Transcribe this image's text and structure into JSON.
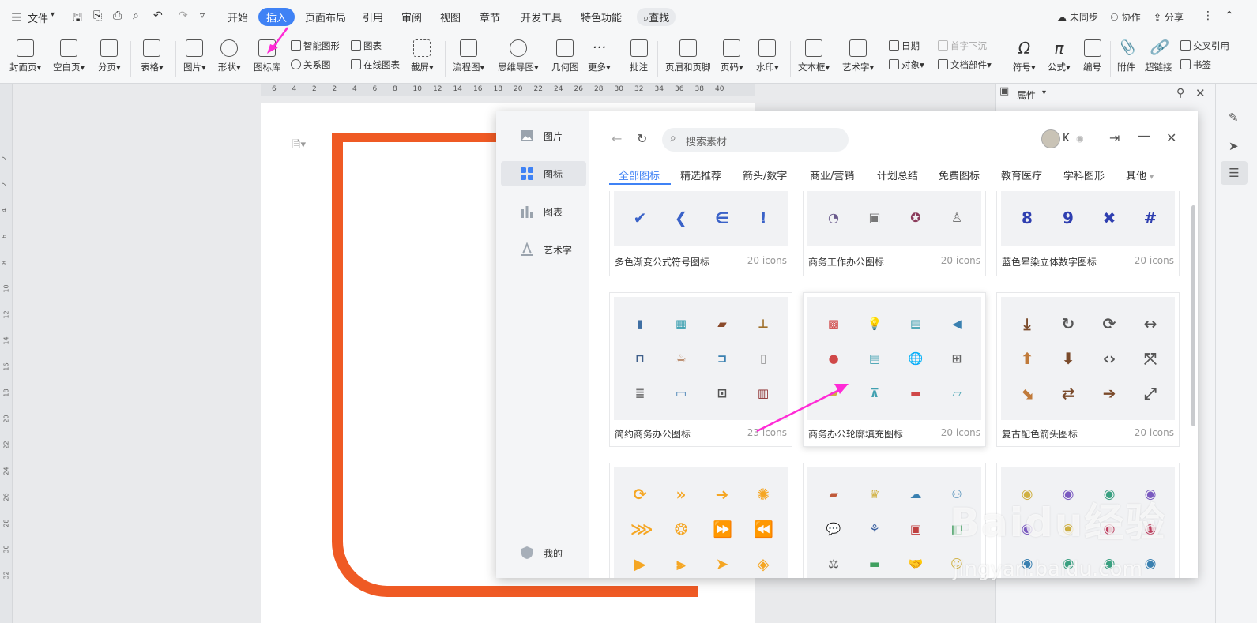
{
  "menubar": {
    "file_label": "文件",
    "tabs": [
      "开始",
      "插入",
      "页面布局",
      "引用",
      "审阅",
      "视图",
      "章节",
      "开发工具",
      "特色功能"
    ],
    "active_tab": "插入",
    "search_label": "查找",
    "sync_label": "未同步",
    "collab_label": "协作",
    "share_label": "分享"
  },
  "ribbon": {
    "big_items": [
      "封面页",
      "空白页",
      "分页",
      "表格",
      "图片",
      "形状",
      "图标库",
      "截屏",
      "流程图",
      "思维导图",
      "几何图",
      "更多",
      "批注",
      "页眉和页脚",
      "页码",
      "水印",
      "文本框",
      "艺术字",
      "符号",
      "公式",
      "编号",
      "附件",
      "超链接"
    ],
    "small_items": [
      "智能图形",
      "图表",
      "关系图",
      "在线图表",
      "日期",
      "首字下沉",
      "对象",
      "文档部件",
      "交叉引用",
      "书签"
    ]
  },
  "ruler": {
    "top_numbers": [
      "6",
      "4",
      "2",
      "2",
      "4",
      "6",
      "8",
      "10",
      "12",
      "14",
      "16",
      "18",
      "20",
      "22",
      "24",
      "26",
      "28",
      "30",
      "32",
      "34",
      "36",
      "38",
      "40"
    ],
    "left_numbers": [
      "2",
      "2",
      "4",
      "6",
      "8",
      "10",
      "12",
      "14",
      "16",
      "18",
      "20",
      "22",
      "24",
      "26",
      "28",
      "30",
      "32"
    ]
  },
  "props_panel": {
    "title": "属性"
  },
  "dialog": {
    "sidebar": [
      {
        "label": "图片",
        "icon": "image-icon"
      },
      {
        "label": "图标",
        "icon": "icon-grid-icon"
      },
      {
        "label": "图表",
        "icon": "bar-chart-icon"
      },
      {
        "label": "艺术字",
        "icon": "art-text-icon"
      }
    ],
    "sidebar_active": "图标",
    "mine_label": "我的",
    "search_placeholder": "搜索素材",
    "user_name": "K",
    "categories": [
      "全部图标",
      "精选推荐",
      "箭头/数字",
      "商业/营销",
      "计划总结",
      "免费图标",
      "教育医疗",
      "学科图形",
      "其他"
    ],
    "active_category": "全部图标",
    "cards": [
      {
        "name": "多色渐变公式符号图标",
        "count": "20 icons"
      },
      {
        "name": "商务工作办公图标",
        "count": "20 icons"
      },
      {
        "name": "蓝色晕染立体数字图标",
        "count": "20 icons"
      },
      {
        "name": "简约商务办公图标",
        "count": "23 icons"
      },
      {
        "name": "商务办公轮廓填充图标",
        "count": "20 icons"
      },
      {
        "name": "复古配色箭头图标",
        "count": "20 icons"
      },
      {
        "name": "",
        "count": ""
      },
      {
        "name": "",
        "count": ""
      },
      {
        "name": "",
        "count": ""
      }
    ]
  },
  "watermark": {
    "text": "Baidu经验",
    "url": "jingyan.baidu.com"
  },
  "colors": {
    "accent": "#3f82f5",
    "frame": "#ef5a24",
    "annotation": "#ff2bd6"
  }
}
